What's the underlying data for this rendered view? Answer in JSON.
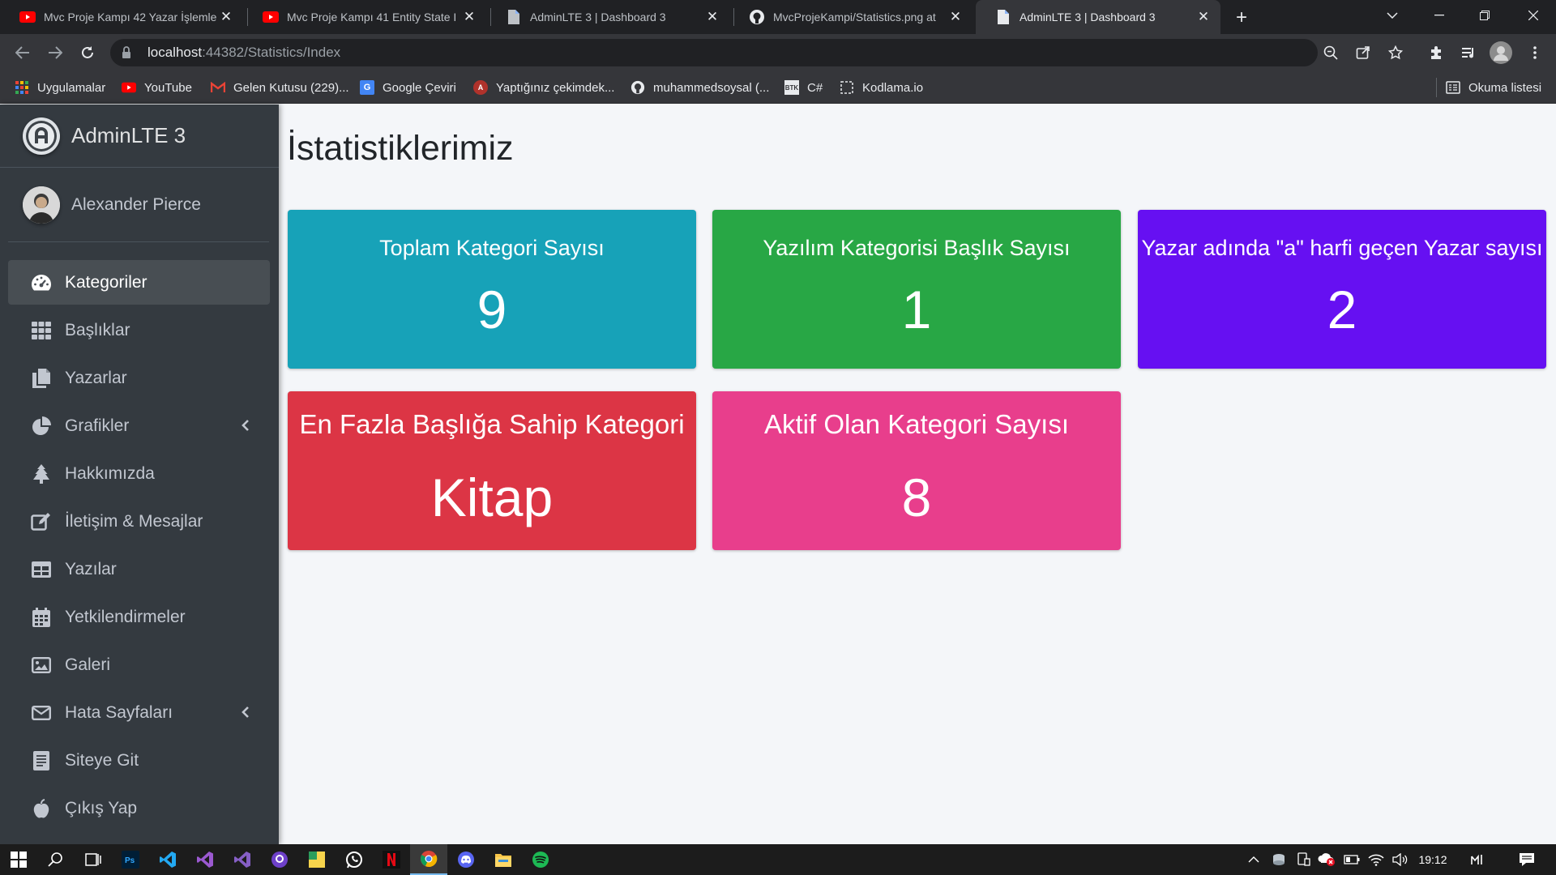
{
  "browser": {
    "tabs": [
      {
        "title": "Mvc Proje Kampı 42 Yazar İşlemle",
        "icon": "youtube-icon"
      },
      {
        "title": "Mvc Proje Kampı 41 Entity State I",
        "icon": "youtube-icon"
      },
      {
        "title": "AdminLTE 3 | Dashboard 3",
        "icon": "page-icon"
      },
      {
        "title": "MvcProjeKampi/Statistics.png at",
        "icon": "github-icon"
      },
      {
        "title": "AdminLTE 3 | Dashboard 3",
        "icon": "page-icon"
      }
    ],
    "close_glyph": "✕",
    "new_tab_glyph": "+",
    "url_host": "localhost",
    "url_rest": ":44382/Statistics/Index",
    "bookmarks": [
      {
        "label": "Uygulamalar",
        "icon": "apps-grid-icon"
      },
      {
        "label": "YouTube",
        "icon": "youtube-icon"
      },
      {
        "label": "Gelen Kutusu (229)...",
        "icon": "gmail-icon"
      },
      {
        "label": "Google Çeviri",
        "icon": "translate-icon"
      },
      {
        "label": "Yaptığınız çekimdek...",
        "icon": "site-icon"
      },
      {
        "label": "muhammedsoysal (...",
        "icon": "github-icon"
      },
      {
        "label": "C#",
        "icon": "btk-icon"
      },
      {
        "label": "Kodlama.io",
        "icon": "kodlama-icon"
      }
    ],
    "reading_list": "Okuma listesi"
  },
  "sidebar": {
    "brand": "AdminLTE 3",
    "user": "Alexander Pierce",
    "items": [
      {
        "label": "Kategoriler",
        "icon": "dashboard-gauge-icon",
        "active": true
      },
      {
        "label": "Başlıklar",
        "icon": "grid-icon"
      },
      {
        "label": "Yazarlar",
        "icon": "copy-icon"
      },
      {
        "label": "Grafikler",
        "icon": "pie-chart-icon",
        "has_children": true
      },
      {
        "label": "Hakkımızda",
        "icon": "tree-icon"
      },
      {
        "label": "İletişim & Mesajlar",
        "icon": "edit-icon"
      },
      {
        "label": "Yazılar",
        "icon": "table-icon"
      },
      {
        "label": "Yetkilendirmeler",
        "icon": "calendar-icon"
      },
      {
        "label": "Galeri",
        "icon": "image-icon"
      },
      {
        "label": "Hata Sayfaları",
        "icon": "envelope-icon",
        "has_children": true
      },
      {
        "label": "Siteye Git",
        "icon": "document-icon"
      },
      {
        "label": "Çıkış Yap",
        "icon": "apple-icon"
      }
    ]
  },
  "main": {
    "title": "İstatistiklerimiz",
    "cards": [
      {
        "title": "Toplam Kategori Sayısı",
        "value": "9",
        "color": "#17a2b8"
      },
      {
        "title": "Yazılım Kategorisi Başlık Sayısı",
        "value": "1",
        "color": "#28a745"
      },
      {
        "title": "Yazar adında \"a\" harfi geçen Yazar sayısı",
        "value": "2",
        "color": "#6610f2"
      },
      {
        "title": "En Fazla Başlığa Sahip Kategori",
        "value": "Kitap",
        "color": "#dc3545"
      },
      {
        "title": "Aktif Olan Kategori Sayısı",
        "value": "8",
        "color": "#e83e8c"
      }
    ]
  },
  "taskbar": {
    "clock": "19:12"
  }
}
